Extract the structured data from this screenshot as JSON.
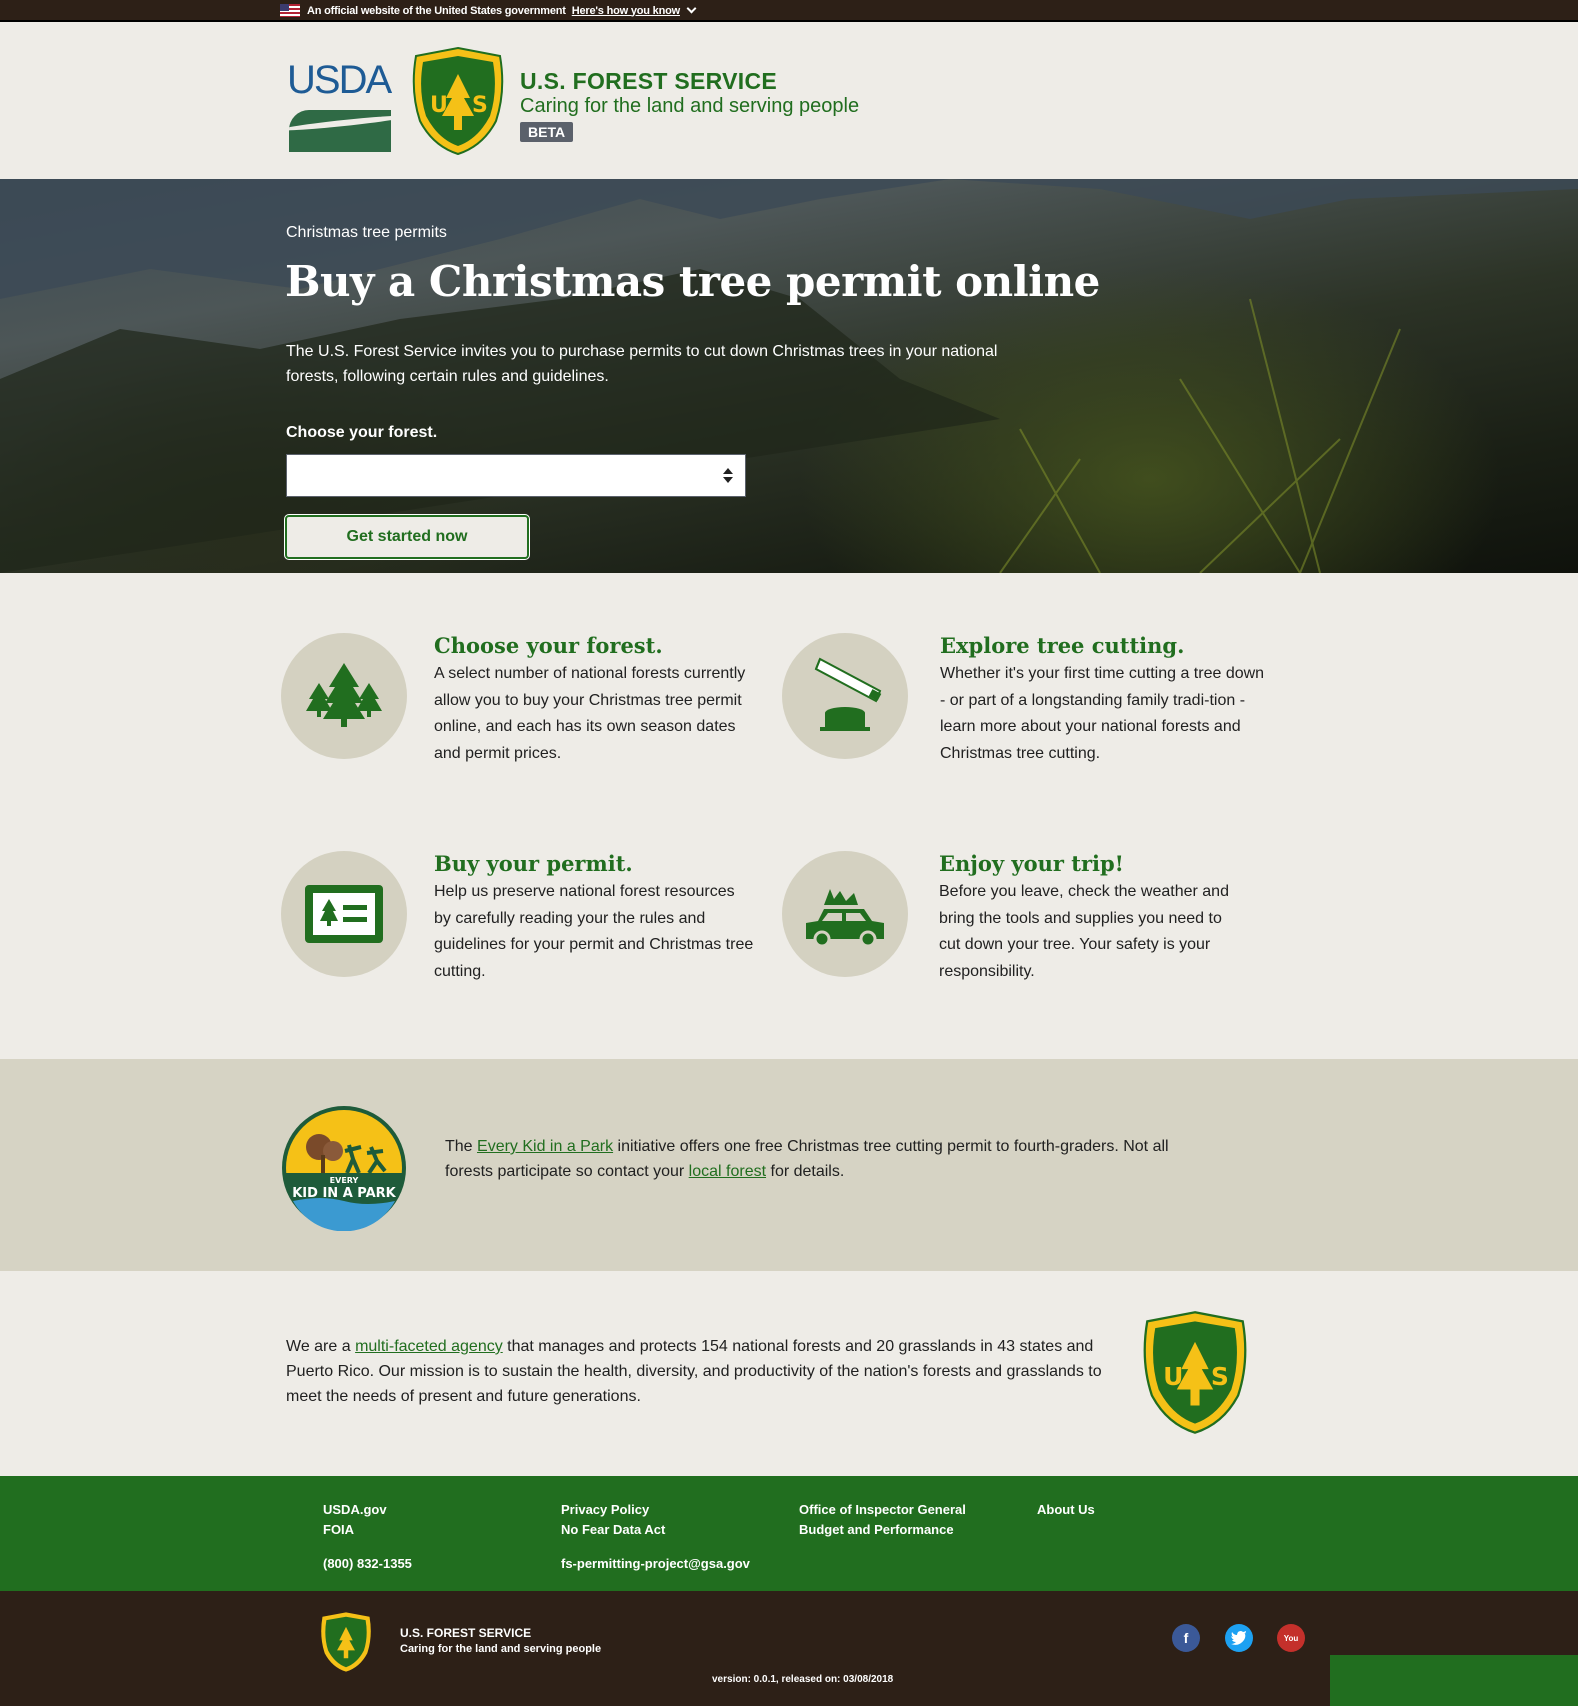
{
  "gov_banner": {
    "text": "An official website of the United States government",
    "link": "Here's how you know"
  },
  "header": {
    "usda_logo": "USDA",
    "title": "U.S. FOREST SERVICE",
    "tagline": "Caring for the land and serving people",
    "badge": "BETA"
  },
  "hero": {
    "eyebrow": "Christmas tree permits",
    "title": "Buy a Christmas tree permit online",
    "description": "The U.S. Forest Service invites you to purchase permits to cut down Christmas trees in your national forests, following certain rules and guidelines.",
    "select_label": "Choose your forest.",
    "select_value": "",
    "button": "Get started now"
  },
  "steps": [
    {
      "title": "Choose your forest.",
      "text": "A select number of national forests currently allow you to buy your Christmas tree permit online, and each has its own season dates and permit prices.",
      "icon": "trees-icon"
    },
    {
      "title": "Explore tree cutting.",
      "text": "Whether it's your first time cutting a tree down - or part of a longstanding family tradi-tion - learn more about your national forests and Christmas tree cutting.",
      "icon": "saw-stump-icon"
    },
    {
      "title": "Buy your permit.",
      "text": "Help us preserve national forest resources by carefully reading your the rules and guidelines for your permit and Christmas tree cutting.",
      "icon": "permit-card-icon"
    },
    {
      "title": "Enjoy your trip!",
      "text": "Before you leave, check the weather and bring the tools and supplies you need to cut down your tree. Your safety is your responsibility.",
      "icon": "car-tree-icon"
    }
  ],
  "kid": {
    "badge_text_top": "EVERY",
    "badge_text_main": "KID IN A PARK",
    "pre": "The ",
    "link1": "Every Kid in a Park",
    "mid": " initiative offers one free Christmas tree cutting permit to fourth-graders. Not all forests participate so contact your ",
    "link2": "local forest",
    "post": " for details."
  },
  "mission": {
    "pre": "We are a ",
    "link": "multi-faceted agency",
    "post": " that manages and protects 154 national forests and 20 grasslands in 43 states and Puerto Rico. Our mission is to sustain the health, diversity, and productivity of the nation's forests and grasslands to meet the needs of present and future generations."
  },
  "footer": {
    "col1": {
      "a": "USDA.gov",
      "b": "FOIA",
      "c": "(800) 832-1355"
    },
    "col2": {
      "a": "Privacy Policy",
      "b": "No Fear Data Act",
      "c": "fs-permitting-project@gsa.gov"
    },
    "col3": {
      "a": "Office of Inspector General",
      "b": "Budget and Performance"
    },
    "col4": {
      "a": "About Us"
    },
    "title": "U.S. FOREST SERVICE",
    "tagline": "Caring for the land and serving people",
    "social": {
      "facebook": "f",
      "youtube": "You"
    },
    "version": "version: 0.0.1, released on: 03/08/2018"
  },
  "colors": {
    "brand_green": "#216e1f",
    "gold": "#f5c117",
    "dark_brown": "#2d2017",
    "tan": "#d4d1c1"
  }
}
